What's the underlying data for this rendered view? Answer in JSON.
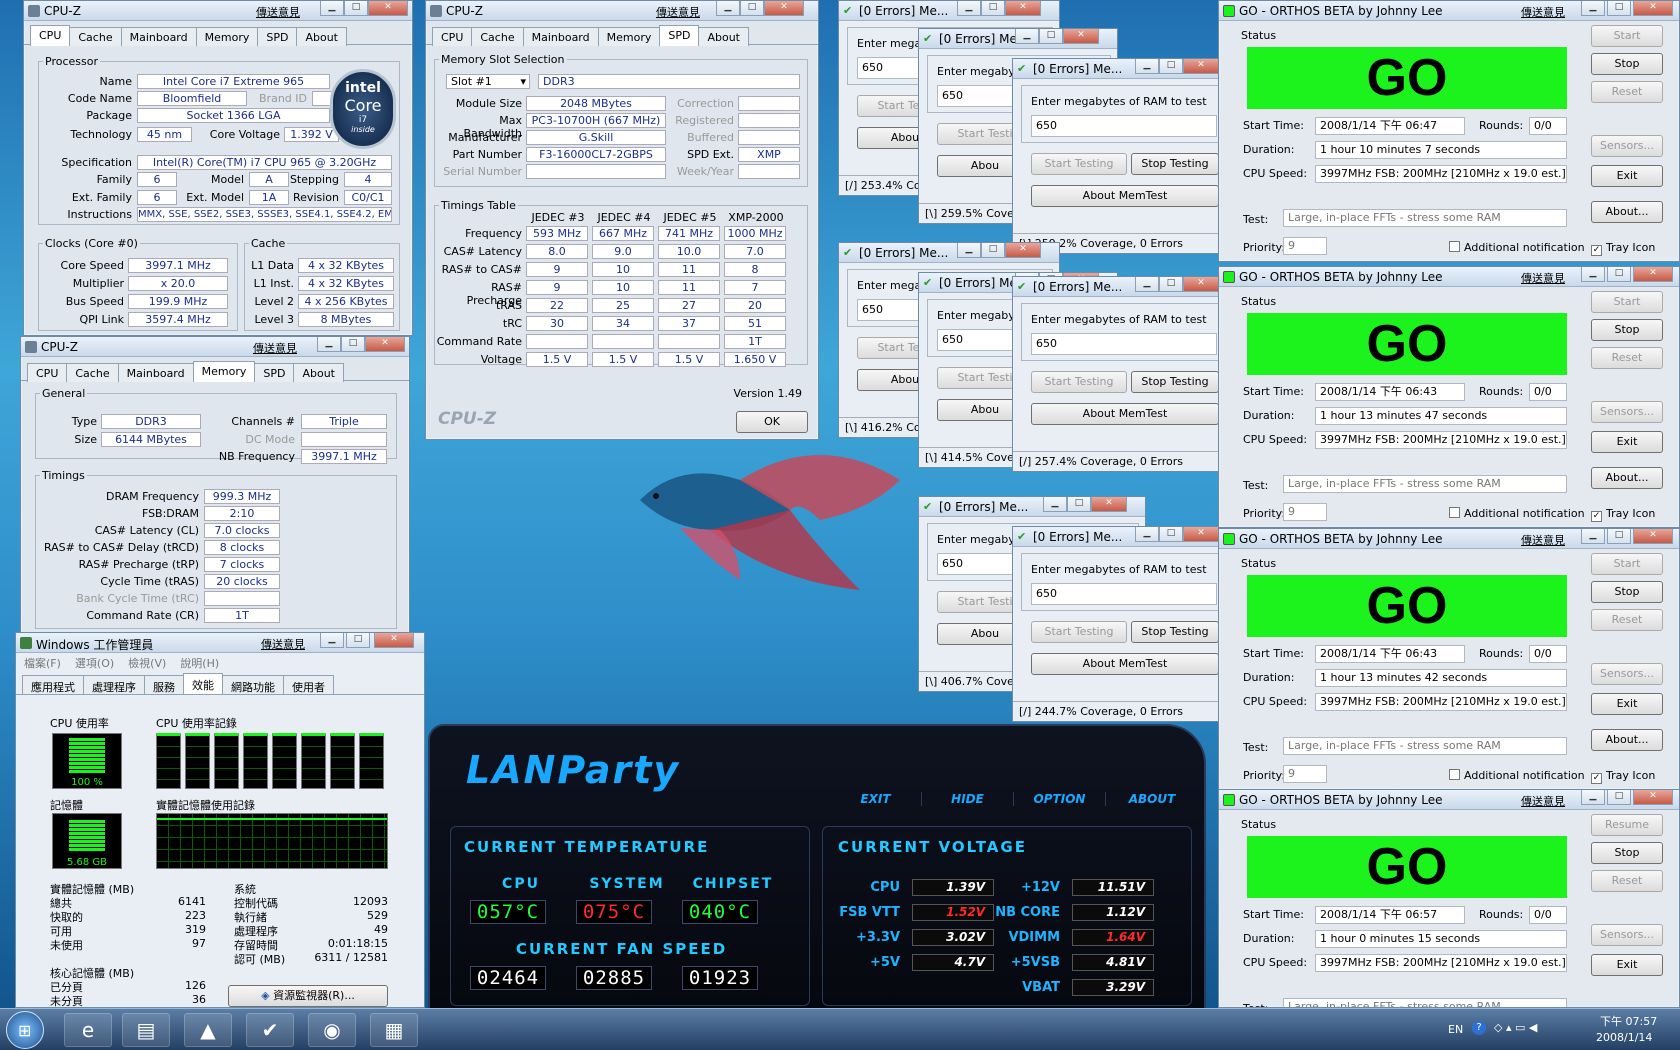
{
  "cpuz1": {
    "title": "CPU-Z",
    "link": "傳送意見",
    "tabs": [
      "CPU",
      "Cache",
      "Mainboard",
      "Memory",
      "SPD",
      "About"
    ],
    "processor_legend": "Processor",
    "name_l": "Name",
    "name": "Intel Core i7 Extreme 965",
    "codename_l": "Code Name",
    "codename": "Bloomfield",
    "brandid_l": "Brand ID",
    "package_l": "Package",
    "package": "Socket 1366 LGA",
    "tech_l": "Technology",
    "tech": "45 nm",
    "cv_l": "Core Voltage",
    "cv": "1.392 V",
    "spec_l": "Specification",
    "spec": "Intel(R) Core(TM) i7 CPU       965  @ 3.20GHz",
    "family_l": "Family",
    "family": "6",
    "model_l": "Model",
    "model": "A",
    "stepping_l": "Stepping",
    "stepping": "4",
    "extfam_l": "Ext. Family",
    "extfam": "6",
    "extmodel_l": "Ext. Model",
    "extmodel": "1A",
    "revision_l": "Revision",
    "revision": "C0/C1",
    "instr_l": "Instructions",
    "instr": "MMX, SSE, SSE2, SSE3, SSSE3, SSE4.1, SSE4.2, EM64T",
    "clocks_legend": "Clocks (Core #0)",
    "corespeed_l": "Core Speed",
    "corespeed": "3997.1 MHz",
    "mult_l": "Multiplier",
    "mult": "x 20.0",
    "bus_l": "Bus Speed",
    "bus": "199.9 MHz",
    "qpi_l": "QPI Link",
    "qpi": "3597.4 MHz",
    "cache_legend": "Cache",
    "l1d_l": "L1 Data",
    "l1d": "4 x 32 KBytes",
    "l1i_l": "L1 Inst.",
    "l1i": "4 x 32 KBytes",
    "l2_l": "Level 2",
    "l2": "4 x 256 KBytes",
    "l3_l": "Level 3",
    "l3": "8 MBytes",
    "logo1": "intel",
    "logo2": "Core",
    "logo3": "i7",
    "logo4": "inside"
  },
  "cpuz2": {
    "title": "CPU-Z",
    "link": "傳送意見",
    "tabs": [
      "CPU",
      "Cache",
      "Mainboard",
      "Memory",
      "SPD",
      "About"
    ],
    "general_legend": "General",
    "type_l": "Type",
    "type": "DDR3",
    "channels_l": "Channels #",
    "channels": "Triple",
    "size_l": "Size",
    "size": "6144 MBytes",
    "dcmode_l": "DC Mode",
    "nbfreq_l": "NB Frequency",
    "nbfreq": "3997.1 MHz",
    "timings_legend": "Timings",
    "rows": [
      [
        "DRAM Frequency",
        "999.3 MHz"
      ],
      [
        "FSB:DRAM",
        "2:10"
      ],
      [
        "CAS# Latency (CL)",
        "7.0 clocks"
      ],
      [
        "RAS# to CAS# Delay (tRCD)",
        "8 clocks"
      ],
      [
        "RAS# Precharge (tRP)",
        "7 clocks"
      ],
      [
        "Cycle Time (tRAS)",
        "20 clocks"
      ],
      [
        "Bank Cycle Time (tRC)",
        ""
      ],
      [
        "Command Rate (CR)",
        "1T"
      ]
    ]
  },
  "cpuz3": {
    "title": "CPU-Z",
    "link": "傳送意見",
    "tabs": [
      "CPU",
      "Cache",
      "Mainboard",
      "Memory",
      "SPD",
      "About"
    ],
    "slot_legend": "Memory Slot Selection",
    "slot": "Slot #1",
    "slottype": "DDR3",
    "modsize_l": "Module Size",
    "modsize": "2048 MBytes",
    "correction_l": "Correction",
    "maxbw_l": "Max Bandwidth",
    "maxbw": "PC3-10700H (667 MHz)",
    "registered_l": "Registered",
    "mfr_l": "Manufacturer",
    "mfr": "G.Skill",
    "buffered_l": "Buffered",
    "part_l": "Part Number",
    "part": "F3-16000CL7-2GBPS",
    "spdext_l": "SPD Ext.",
    "spdext": "XMP",
    "serial_l": "Serial Number",
    "week_l": "Week/Year",
    "timings_legend": "Timings Table",
    "cols": [
      "JEDEC #3",
      "JEDEC #4",
      "JEDEC #5",
      "XMP-2000"
    ],
    "rows": [
      [
        "Frequency",
        "593 MHz",
        "667 MHz",
        "741 MHz",
        "1000 MHz"
      ],
      [
        "CAS# Latency",
        "8.0",
        "9.0",
        "10.0",
        "7.0"
      ],
      [
        "RAS# to CAS#",
        "9",
        "10",
        "11",
        "8"
      ],
      [
        "RAS# Precharge",
        "9",
        "10",
        "11",
        "7"
      ],
      [
        "tRAS",
        "22",
        "25",
        "27",
        "20"
      ],
      [
        "tRC",
        "30",
        "34",
        "37",
        "51"
      ],
      [
        "Command Rate",
        "",
        "",
        "",
        "1T"
      ],
      [
        "Voltage",
        "1.5 V",
        "1.5 V",
        "1.5 V",
        "1.650 V"
      ]
    ],
    "version": "Version 1.49",
    "brand": "CPU-Z",
    "ok": "OK"
  },
  "memtest": {
    "title": "[0 Errors] Me...",
    "prompt": "Enter megabytes of RAM to test",
    "prompt_short": "Enter megaby",
    "value": "650",
    "start": "Start Testing",
    "start_short": "Start Testi",
    "stop": "Stop Testing",
    "about": "About MemTest",
    "about_short": "Abou",
    "status": [
      "[/]  253.4% Co",
      "[\\]  259.5% Cove",
      "[\\]  259.2% Coverage, 0 Errors",
      "[\\]  416.2% Co",
      "[\\]  414.5% Cove",
      "[/]  257.4% Coverage, 0 Errors",
      "[\\]  406.7% Cove",
      "[/]  244.7% Coverage, 0 Errors"
    ]
  },
  "orthos": {
    "title": "GO - ORTHOS BETA by Johnny Lee",
    "link": "傳送意見",
    "status_l": "Status",
    "go": "GO",
    "start_l": "Start Time:",
    "rounds_l": "Rounds:",
    "duration_l": "Duration:",
    "cpuspeed_l": "CPU Speed:",
    "cpuspeed": "3997MHz FSB: 200MHz [210MHz x 19.0 est.]",
    "test_l": "Test:",
    "test": "Large, in-place FFTs - stress some RAM",
    "priority_l": "Priority:",
    "priority": "9",
    "notif": "Additional notification",
    "tray": "Tray Icon",
    "btn_start": "Start",
    "btn_resume": "Resume",
    "btn_stop": "Stop",
    "btn_reset": "Reset",
    "btn_sensors": "Sensors...",
    "btn_exit": "Exit",
    "btn_about": "About...",
    "windows": [
      {
        "start": "2008/1/14 下午 06:47",
        "rounds": "0/0",
        "duration": "1 hour 10 minutes 7 seconds"
      },
      {
        "start": "2008/1/14 下午 06:43",
        "rounds": "0/0",
        "duration": "1 hour 13 minutes 47 seconds"
      },
      {
        "start": "2008/1/14 下午 06:43",
        "rounds": "0/0",
        "duration": "1 hour 13 minutes 42 seconds"
      },
      {
        "start": "2008/1/14 下午 06:57",
        "rounds": "0/0",
        "duration": "1 hour 0 minutes 15 seconds"
      }
    ]
  },
  "taskmgr": {
    "title": "Windows 工作管理員",
    "link": "傳送意見",
    "menu": [
      "檔案(F)",
      "選項(O)",
      "檢視(V)",
      "說明(H)"
    ],
    "tabs": [
      "應用程式",
      "處理程序",
      "服務",
      "效能",
      "網路功能",
      "使用者"
    ],
    "cpu_usage_l": "CPU 使用率",
    "cpu_usage": "100 %",
    "cpu_hist_l": "CPU 使用率記錄",
    "mem_l": "記憶體",
    "mem": "5.68 GB",
    "mem_hist_l": "實體記憶體使用記錄",
    "phys_l": "實體記憶體 (MB)",
    "phys": [
      [
        "總共",
        "6141"
      ],
      [
        "快取的",
        "223"
      ],
      [
        "可用",
        "319"
      ],
      [
        "未使用",
        "97"
      ]
    ],
    "sys_l": "系統",
    "sys": [
      [
        "控制代碼",
        "12093"
      ],
      [
        "執行緒",
        "529"
      ],
      [
        "處理程序",
        "49"
      ],
      [
        "存留時間",
        "0:01:18:15"
      ],
      [
        "認可 (MB)",
        "6311 / 12581"
      ]
    ],
    "kernel_l": "核心記憶體 (MB)",
    "kernel": [
      [
        "已分頁",
        "126"
      ],
      [
        "未分頁",
        "36"
      ]
    ],
    "resmon": "資源監視器(R)...",
    "cpu_level": 1.0
  },
  "lanparty": {
    "logo": "LANParty",
    "menu": [
      "EXIT",
      "HIDE",
      "OPTION",
      "ABOUT"
    ],
    "temp_title": "CURRENT TEMPERATURE",
    "fan_title": "CURRENT FAN SPEED",
    "volt_title": "CURRENT VOLTAGE",
    "temp_labels": [
      "CPU",
      "SYSTEM",
      "CHIPSET"
    ],
    "temps": [
      "057°C",
      "075°C",
      "040°C"
    ],
    "fans": [
      "02464",
      "02885",
      "01923"
    ],
    "volts_left": [
      [
        "CPU",
        "1.39V"
      ],
      [
        "FSB VTT",
        "1.52V"
      ],
      [
        "+3.3V",
        "3.02V"
      ],
      [
        "+5V",
        "4.7V"
      ]
    ],
    "volts_right": [
      [
        "+12V",
        "11.51V"
      ],
      [
        "NB CORE",
        "1.12V"
      ],
      [
        "VDIMM",
        "1.64V"
      ],
      [
        "+5VSB",
        "4.81V"
      ],
      [
        "VBAT",
        "3.29V"
      ]
    ],
    "colors": {
      "ok": "#1cff3a",
      "hot": "#ff2a2a",
      "accent": "#25c8ff"
    }
  },
  "taskbar": {
    "lang": "EN",
    "time": "下午 07:57",
    "date": "2008/1/14",
    "apps": [
      "ie-icon",
      "explorer-icon",
      "cpuz-icon",
      "memtest-icon",
      "dfi-icon",
      "taskmgr-icon"
    ]
  }
}
